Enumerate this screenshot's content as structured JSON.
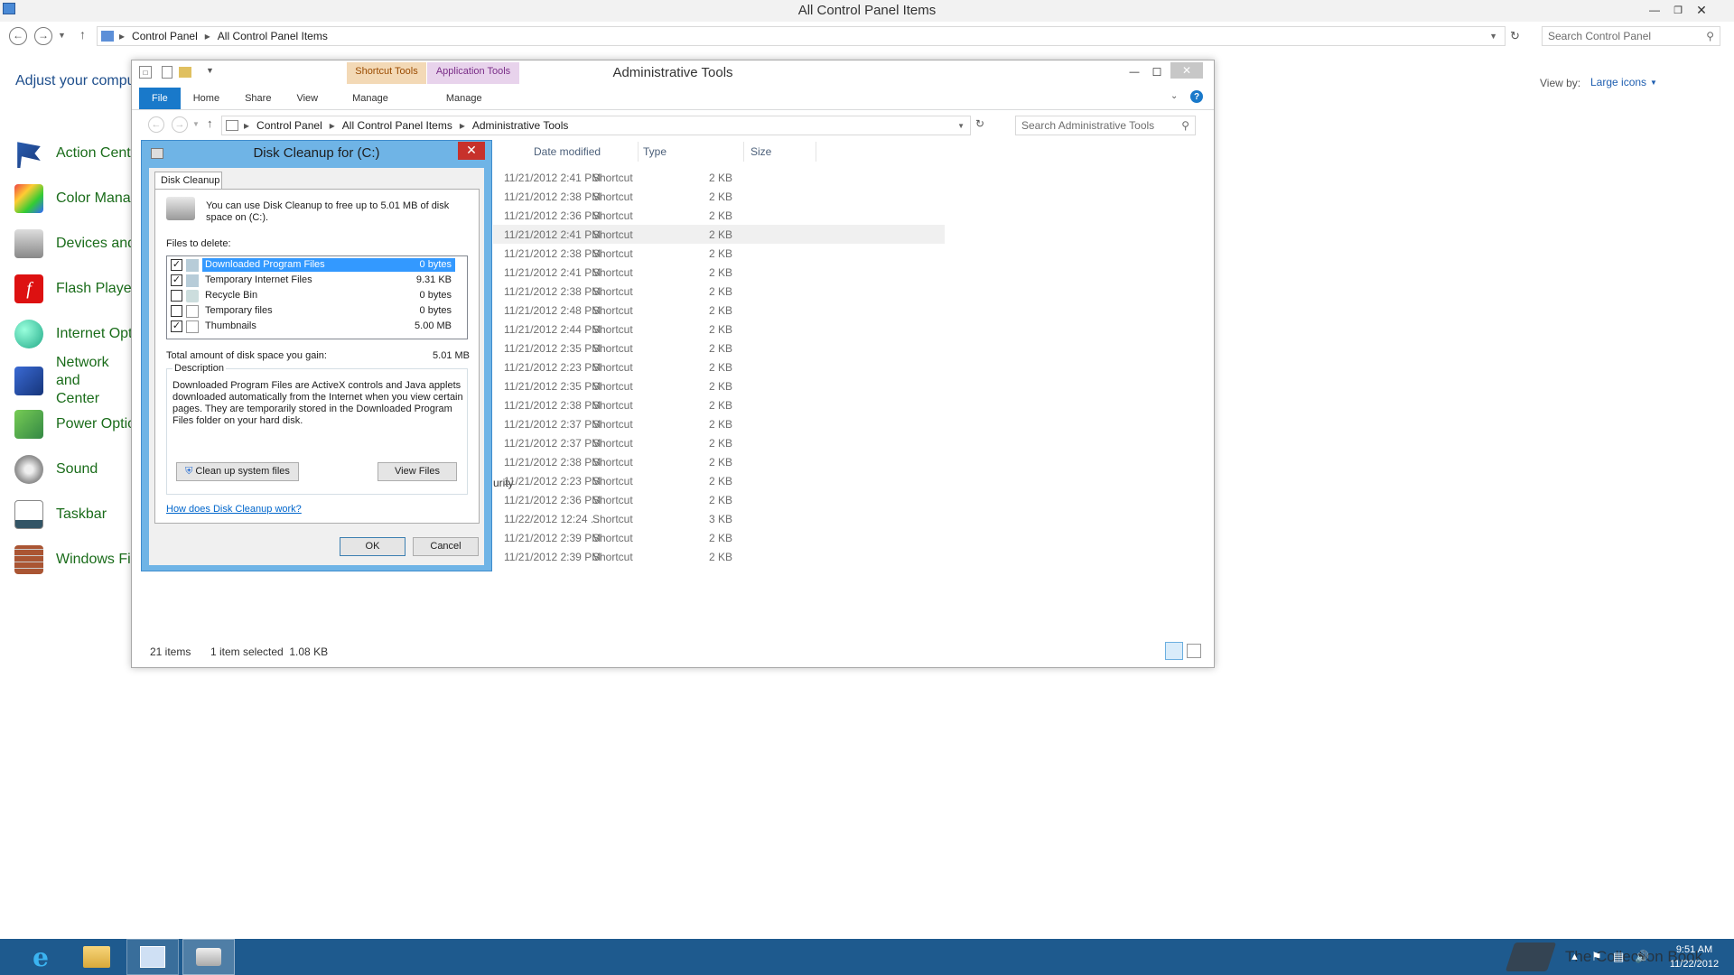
{
  "main_window": {
    "title": "All Control Panel Items",
    "breadcrumb": [
      "Control Panel",
      "All Control Panel Items"
    ],
    "search_placeholder": "Search Control Panel",
    "header_text": "Adjust your compu",
    "view_by_label": "View by:",
    "view_by_value": "Large icons",
    "items": [
      {
        "label": "Action Cente",
        "icon": "flag-icon"
      },
      {
        "label": "Color Manag",
        "icon": "color-icon"
      },
      {
        "label": "Devices and",
        "icon": "printer-icon"
      },
      {
        "label": "Flash Player",
        "icon": "flash-icon"
      },
      {
        "label": "Internet Opt",
        "icon": "globe-icon"
      },
      {
        "label": "Network and\nCenter",
        "icon": "network-icon"
      },
      {
        "label": "Power Optio",
        "icon": "power-icon"
      },
      {
        "label": "Sound",
        "icon": "speaker-icon"
      },
      {
        "label": "Taskbar",
        "icon": "taskbar-icon"
      },
      {
        "label": "Windows Fi",
        "icon": "firewall-icon"
      }
    ]
  },
  "admin_window": {
    "title": "Administrative Tools",
    "context_tabs": [
      {
        "label": "Shortcut Tools",
        "color": "#f3d9b6"
      },
      {
        "label": "Application Tools",
        "color": "#e8d3ec"
      }
    ],
    "ribbon_tabs": [
      "File",
      "Home",
      "Share",
      "View",
      "Manage",
      "Manage"
    ],
    "breadcrumb": [
      "Control Panel",
      "All Control Panel Items",
      "Administrative Tools"
    ],
    "search_placeholder": "Search Administrative Tools",
    "columns": [
      "Date modified",
      "Type",
      "Size"
    ],
    "partial_text": "urity",
    "rows": [
      {
        "date": "11/21/2012 2:41 PM",
        "type": "Shortcut",
        "size": "2 KB"
      },
      {
        "date": "11/21/2012 2:38 PM",
        "type": "Shortcut",
        "size": "2 KB"
      },
      {
        "date": "11/21/2012 2:36 PM",
        "type": "Shortcut",
        "size": "2 KB"
      },
      {
        "date": "11/21/2012 2:41 PM",
        "type": "Shortcut",
        "size": "2 KB"
      },
      {
        "date": "11/21/2012 2:38 PM",
        "type": "Shortcut",
        "size": "2 KB"
      },
      {
        "date": "11/21/2012 2:41 PM",
        "type": "Shortcut",
        "size": "2 KB"
      },
      {
        "date": "11/21/2012 2:38 PM",
        "type": "Shortcut",
        "size": "2 KB"
      },
      {
        "date": "11/21/2012 2:48 PM",
        "type": "Shortcut",
        "size": "2 KB"
      },
      {
        "date": "11/21/2012 2:44 PM",
        "type": "Shortcut",
        "size": "2 KB"
      },
      {
        "date": "11/21/2012 2:35 PM",
        "type": "Shortcut",
        "size": "2 KB"
      },
      {
        "date": "11/21/2012 2:23 PM",
        "type": "Shortcut",
        "size": "2 KB"
      },
      {
        "date": "11/21/2012 2:35 PM",
        "type": "Shortcut",
        "size": "2 KB"
      },
      {
        "date": "11/21/2012 2:38 PM",
        "type": "Shortcut",
        "size": "2 KB"
      },
      {
        "date": "11/21/2012 2:37 PM",
        "type": "Shortcut",
        "size": "2 KB"
      },
      {
        "date": "11/21/2012 2:37 PM",
        "type": "Shortcut",
        "size": "2 KB"
      },
      {
        "date": "11/21/2012 2:38 PM",
        "type": "Shortcut",
        "size": "2 KB"
      },
      {
        "date": "11/21/2012 2:23 PM",
        "type": "Shortcut",
        "size": "2 KB"
      },
      {
        "date": "11/21/2012 2:36 PM",
        "type": "Shortcut",
        "size": "2 KB"
      },
      {
        "date": "11/22/2012 12:24 ...",
        "type": "Shortcut",
        "size": "3 KB"
      },
      {
        "date": "11/21/2012 2:39 PM",
        "type": "Shortcut",
        "size": "2 KB"
      },
      {
        "date": "11/21/2012 2:39 PM",
        "type": "Shortcut",
        "size": "2 KB"
      }
    ],
    "status_count": "21 items",
    "status_selected": "1 item selected  1.08 KB"
  },
  "disk_cleanup": {
    "title": "Disk Cleanup for  (C:)",
    "tab": "Disk Cleanup",
    "intro": "You can use Disk Cleanup to free up to 5.01 MB of disk space on  (C:).",
    "files_label": "Files to delete:",
    "files": [
      {
        "name": "Downloaded Program Files",
        "size": "0 bytes",
        "checked": true,
        "highlighted": true
      },
      {
        "name": "Temporary Internet Files",
        "size": "9.31 KB",
        "checked": true,
        "highlighted": false
      },
      {
        "name": "Recycle Bin",
        "size": "0 bytes",
        "checked": false,
        "highlighted": false
      },
      {
        "name": "Temporary files",
        "size": "0 bytes",
        "checked": false,
        "highlighted": false
      },
      {
        "name": "Thumbnails",
        "size": "5.00 MB",
        "checked": true,
        "highlighted": false
      }
    ],
    "total_label": "Total amount of disk space you gain:",
    "total_value": "5.01 MB",
    "description_label": "Description",
    "description": "Downloaded Program Files are ActiveX controls and Java applets downloaded automatically from the Internet when you view certain pages. They are temporarily stored in the Downloaded Program Files folder on your hard disk.",
    "cleanup_button": "Clean up system files",
    "view_files_button": "View Files",
    "help_link": "How does Disk Cleanup work?",
    "ok_button": "OK",
    "cancel_button": "Cancel"
  },
  "taskbar": {
    "time": "9:51 AM",
    "date": "11/22/2012",
    "watermark": "The Collection Book"
  }
}
